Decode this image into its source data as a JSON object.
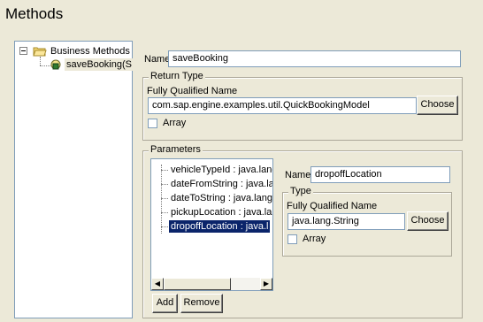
{
  "page": {
    "title": "Methods"
  },
  "tree": {
    "root_label": "Business Methods",
    "child_label": "saveBooking(S"
  },
  "method": {
    "name_label": "Name",
    "name_value": "saveBooking"
  },
  "return_type": {
    "legend": "Return Type",
    "fq_label": "Fully Qualified Name",
    "fq_value": "com.sap.engine.examples.util.QuickBookingModel",
    "choose_label": "Choose",
    "array_label": "Array"
  },
  "parameters": {
    "legend": "Parameters",
    "items": [
      "vehicleTypeId : java.lang",
      "dateFromString : java.lan",
      "dateToString : java.lang",
      "pickupLocation : java.lan",
      "dropoffLocation : java.l"
    ],
    "add_label": "Add",
    "remove_label": "Remove",
    "name_label": "Name",
    "name_value": "dropoffLocation",
    "type_legend": "Type",
    "fq_label": "Fully Qualified Name",
    "fq_value": "java.lang.String",
    "choose_label": "Choose",
    "array_label": "Array"
  },
  "colors": {
    "selection": "#0a246a",
    "background": "#ece9d8"
  }
}
